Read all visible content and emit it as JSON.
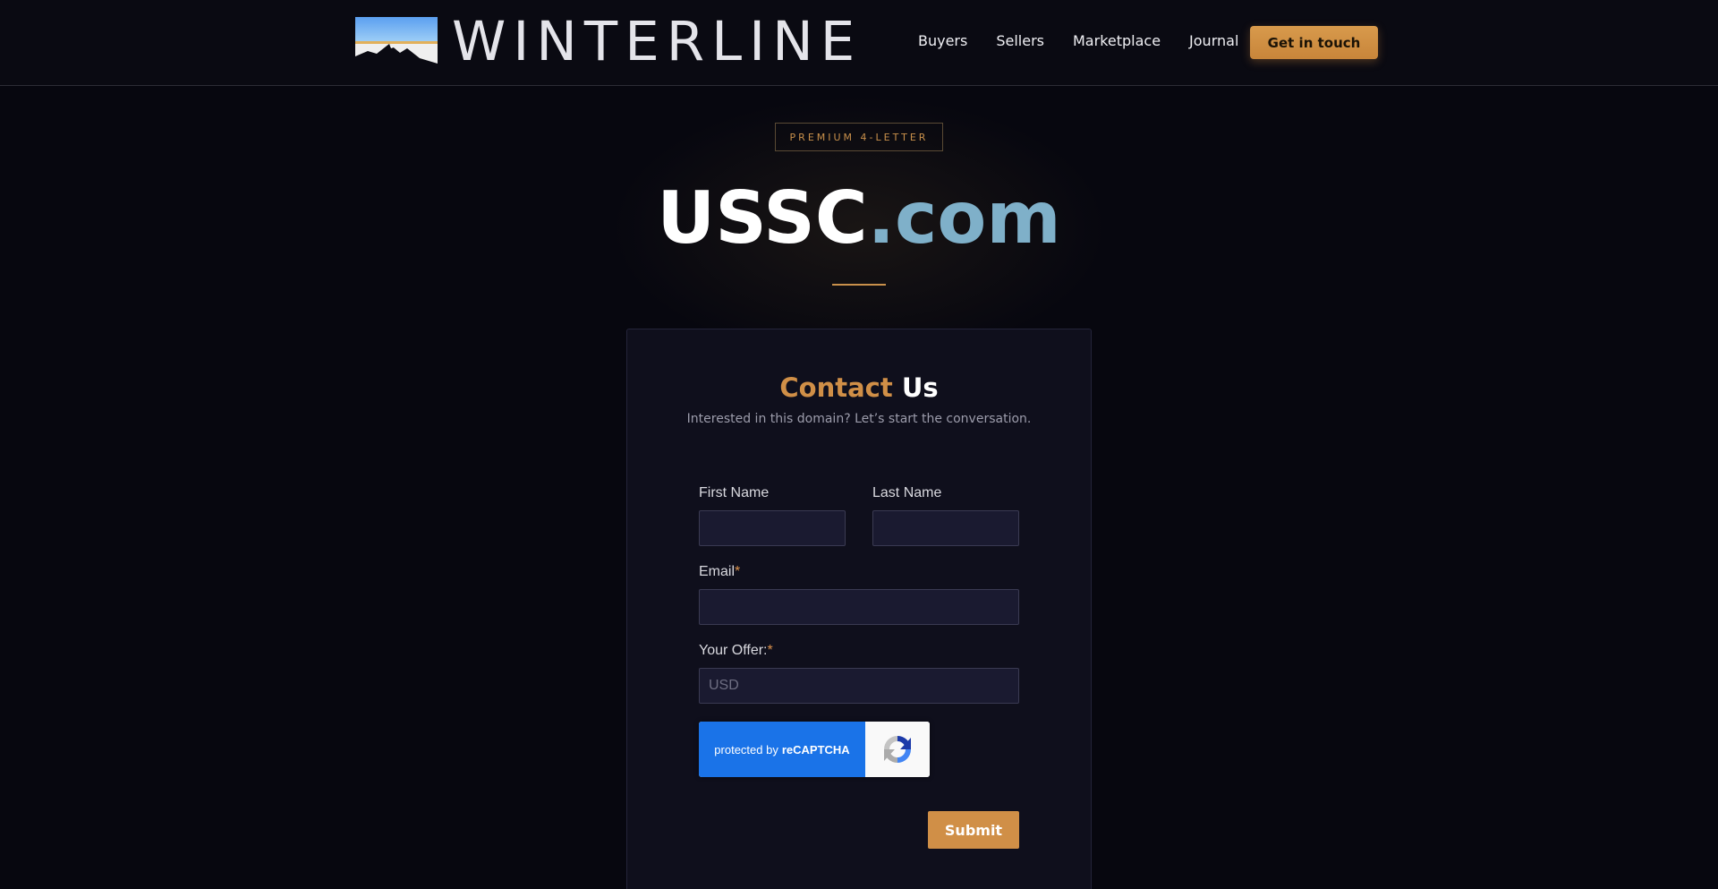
{
  "header": {
    "logo_text": "WINTERLINE",
    "nav": [
      {
        "label": "Buyers"
      },
      {
        "label": "Sellers"
      },
      {
        "label": "Marketplace"
      },
      {
        "label": "Journal"
      }
    ],
    "cta_label": "Get in touch"
  },
  "hero": {
    "badge": "PREMIUM 4-LETTER",
    "domain_name": "USSC",
    "domain_tld": ".com"
  },
  "form": {
    "title_accent": "Contact",
    "title_rest": "Us",
    "subtitle": "Interested in this domain? Let’s start the conversation.",
    "first_name_label": "First Name",
    "last_name_label": "Last Name",
    "email_label": "Email",
    "offer_label": "Your Offer:",
    "required_mark": "*",
    "first_name_value": "",
    "last_name_value": "",
    "email_value": "",
    "offer_placeholder": "USD",
    "recaptcha_prefix": "protected by",
    "recaptcha_brand": "reCAPTCHA",
    "submit_label": "Submit"
  },
  "colors": {
    "accent": "#d08f47",
    "tld": "#7fb0c9",
    "background": "#07070f",
    "recaptcha_blue": "#1a73e8"
  },
  "icons": {
    "logo": "mountain-sky-icon",
    "recaptcha": "recaptcha-icon"
  }
}
